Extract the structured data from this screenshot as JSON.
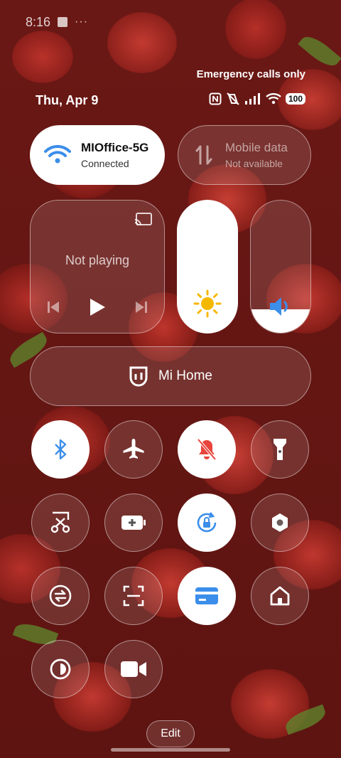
{
  "status_bar": {
    "time": "8:16",
    "overflow": "···"
  },
  "header": {
    "emergency": "Emergency calls only",
    "date": "Thu, Apr 9",
    "battery": "100"
  },
  "wifi": {
    "name": "MIOffice-5G",
    "status": "Connected"
  },
  "mobile_data": {
    "label": "Mobile data",
    "status": "Not available"
  },
  "media": {
    "status": "Not playing"
  },
  "sliders": {
    "brightness_level": 1.0,
    "volume_level": 0.18
  },
  "mi_home": {
    "label": "Mi Home"
  },
  "toggles": [
    {
      "name": "bluetooth",
      "active": true,
      "icon": "bluetooth-icon"
    },
    {
      "name": "airplane-mode",
      "active": false,
      "icon": "airplane-icon"
    },
    {
      "name": "silent-mode",
      "active": true,
      "icon": "bell-off-icon"
    },
    {
      "name": "flashlight",
      "active": false,
      "icon": "flashlight-icon"
    },
    {
      "name": "screenshot",
      "active": false,
      "icon": "scissors-icon"
    },
    {
      "name": "battery-saver",
      "active": false,
      "icon": "battery-plus-icon"
    },
    {
      "name": "rotation-lock",
      "active": true,
      "icon": "rotation-lock-icon"
    },
    {
      "name": "settings",
      "active": false,
      "icon": "hexagon-settings-icon"
    },
    {
      "name": "data-saver",
      "active": false,
      "icon": "sync-icon"
    },
    {
      "name": "scanner",
      "active": false,
      "icon": "scan-icon"
    },
    {
      "name": "cards",
      "active": true,
      "icon": "card-icon"
    },
    {
      "name": "home",
      "active": false,
      "icon": "home-icon"
    },
    {
      "name": "dark-mode",
      "active": false,
      "icon": "dark-mode-icon"
    },
    {
      "name": "video-toolbox",
      "active": false,
      "icon": "video-camera-icon"
    }
  ],
  "footer": {
    "edit_label": "Edit"
  },
  "colors": {
    "accent_blue": "#3b8eea",
    "alert_red": "#e8453c",
    "sun_yellow": "#f5b800"
  }
}
